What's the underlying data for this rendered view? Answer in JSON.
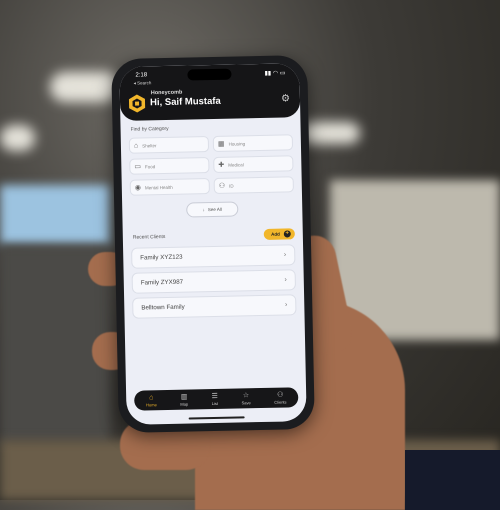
{
  "status": {
    "time": "2:18",
    "back_label": "◂ Search",
    "signal": "▮▮ ◠ ▭"
  },
  "header": {
    "brand": "Honeycomb",
    "greeting": "Hi, Saif Mustafa"
  },
  "categories": {
    "title": "Find by Category",
    "items": [
      {
        "label": "Shelter",
        "icon": "home-icon",
        "glyph": "⌂"
      },
      {
        "label": "Housing",
        "icon": "building-icon",
        "glyph": "▦"
      },
      {
        "label": "Food",
        "icon": "food-icon",
        "glyph": "▭"
      },
      {
        "label": "Medical",
        "icon": "medical-icon",
        "glyph": "✚"
      },
      {
        "label": "Mental Health",
        "icon": "location-pin-icon",
        "glyph": "◉"
      },
      {
        "label": "ID",
        "icon": "people-icon",
        "glyph": "⚇"
      }
    ],
    "see_all": "See All"
  },
  "recent": {
    "title": "Recent Clients",
    "add_label": "Add",
    "clients": [
      {
        "name": "Family XYZ123"
      },
      {
        "name": "Family ZYX987"
      },
      {
        "name": "Belltown Family"
      }
    ]
  },
  "tabs": [
    {
      "label": "Home",
      "icon": "home-icon",
      "glyph": "⌂",
      "active": true
    },
    {
      "label": "Map",
      "icon": "map-icon",
      "glyph": "▥",
      "active": false
    },
    {
      "label": "List",
      "icon": "list-icon",
      "glyph": "☰",
      "active": false
    },
    {
      "label": "Save",
      "icon": "star-icon",
      "glyph": "☆",
      "active": false
    },
    {
      "label": "Clients",
      "icon": "clients-icon",
      "glyph": "⚇",
      "active": false
    }
  ],
  "colors": {
    "accent": "#f1b62b",
    "header_bg": "#151517",
    "screen_bg": "#eceef6"
  }
}
